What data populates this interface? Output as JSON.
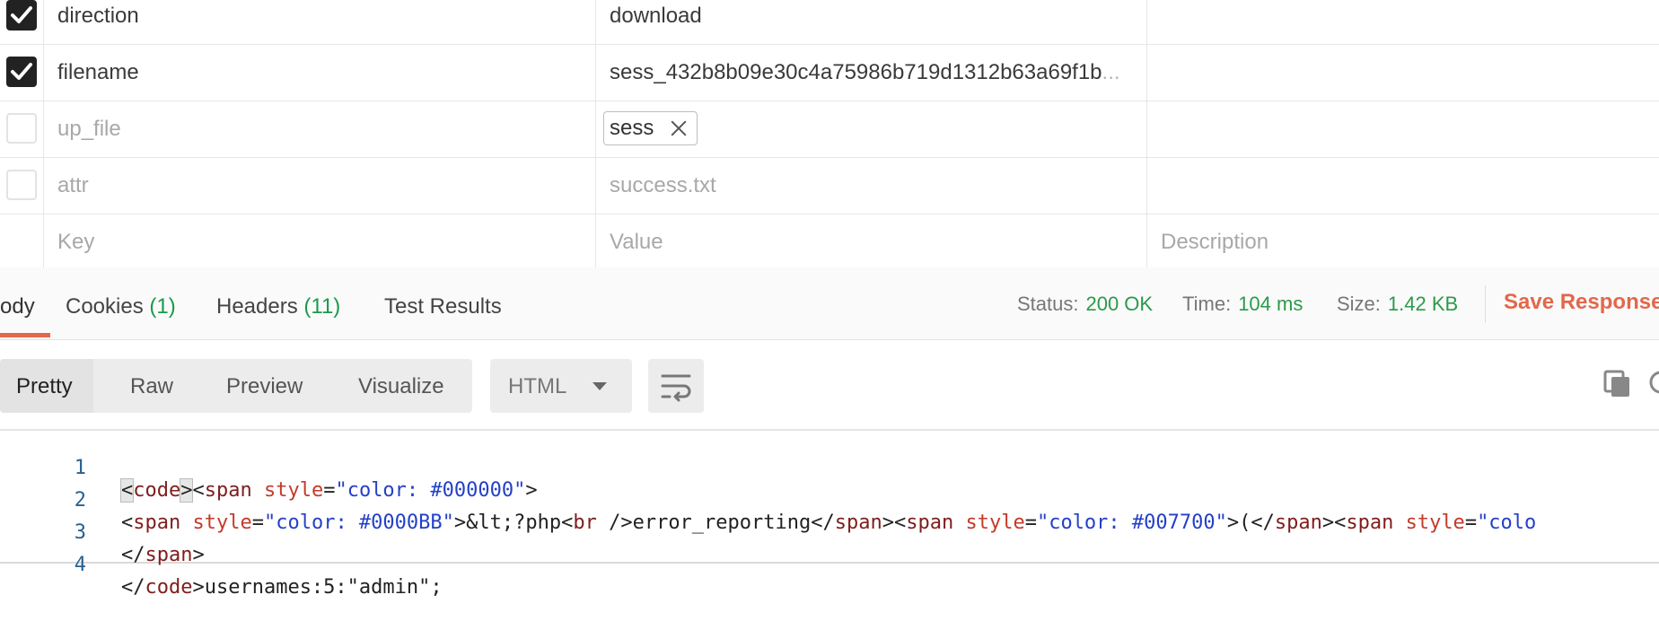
{
  "params": {
    "rows": [
      {
        "checked": true,
        "key": "direction",
        "value": "download",
        "description": ""
      },
      {
        "checked": true,
        "key": "filename",
        "value": "sess_432b8b09e30c4a75986b719d1312b63a69f1b",
        "value_ellipsis": "...",
        "description": ""
      },
      {
        "checked": false,
        "key": "up_file",
        "value_file_chip": "sess",
        "description": ""
      },
      {
        "checked": false,
        "key": "attr",
        "value": "success.txt",
        "description": ""
      }
    ],
    "placeholder_row": {
      "key": "Key",
      "value": "Value",
      "description": "Description"
    }
  },
  "response": {
    "tabs": [
      {
        "label": "ody",
        "count": ""
      },
      {
        "label": "Cookies",
        "count": "(1)"
      },
      {
        "label": "Headers",
        "count": "(11)"
      },
      {
        "label": "Test Results",
        "count": ""
      }
    ],
    "status": {
      "label": "Status:",
      "value": "200 OK"
    },
    "time": {
      "label": "Time:",
      "value": "104 ms"
    },
    "size": {
      "label": "Size:",
      "value": "1.42 KB"
    },
    "save_label": "Save Response"
  },
  "viewer": {
    "modes": [
      "Pretty",
      "Raw",
      "Preview",
      "Visualize"
    ],
    "active_mode": "Pretty",
    "language": "HTML",
    "icons": {
      "wrap": "wrap-lines-icon",
      "copy": "copy-icon",
      "search": "search-icon"
    }
  },
  "code": {
    "lines": [
      {
        "num": "1"
      },
      {
        "num": "2"
      },
      {
        "num": "3"
      },
      {
        "num": "4"
      }
    ],
    "line1": {
      "t1": "<",
      "t2": "code",
      "t3": ">",
      "t4": "<",
      "t5": "span",
      "t6": "style",
      "t7": "=",
      "t8": "\"color: #000000\"",
      "t9": ">"
    },
    "line2": {
      "a": "<",
      "b": "span",
      "c": "style",
      "d": "=",
      "e": "\"color: #0000BB\"",
      "f": ">&lt;?php<",
      "g": "br",
      "h": " />error_reporting</",
      "i": "span",
      "j": "><",
      "k": "span",
      "l": "style",
      "m": "=",
      "n": "\"color: #007700\"",
      "o": ">(</",
      "p": "span",
      "q": "><",
      "r": "span",
      "s": "style",
      "t": "=",
      "u": "\"colo"
    },
    "line3": {
      "a": "</",
      "b": "span",
      "c": ">"
    },
    "line4": {
      "a": "</",
      "b": "code",
      "c": ">usernames:5:\"admin\";"
    }
  }
}
